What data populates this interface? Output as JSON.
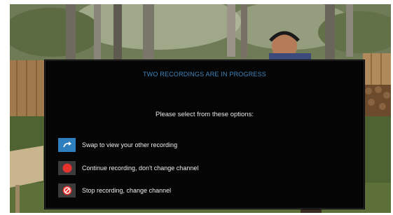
{
  "dialog": {
    "title": "TWO RECORDINGS ARE IN PROGRESS",
    "subtitle": "Please select from these options:",
    "options": [
      {
        "label": "Swap to view your other recording",
        "icon": "swap-arrow-icon",
        "icon_bg": "#2f7fbf"
      },
      {
        "label": "Continue recording, don't change channel",
        "icon": "record-dot-icon",
        "icon_bg": "#3b3b3b"
      },
      {
        "label": "Stop recording, change channel",
        "icon": "stop-record-icon",
        "icon_bg": "#3b3b3b"
      }
    ]
  },
  "colors": {
    "title": "#3f86bf",
    "record_red": "#e8322e",
    "dialog_bg": "#050505"
  }
}
